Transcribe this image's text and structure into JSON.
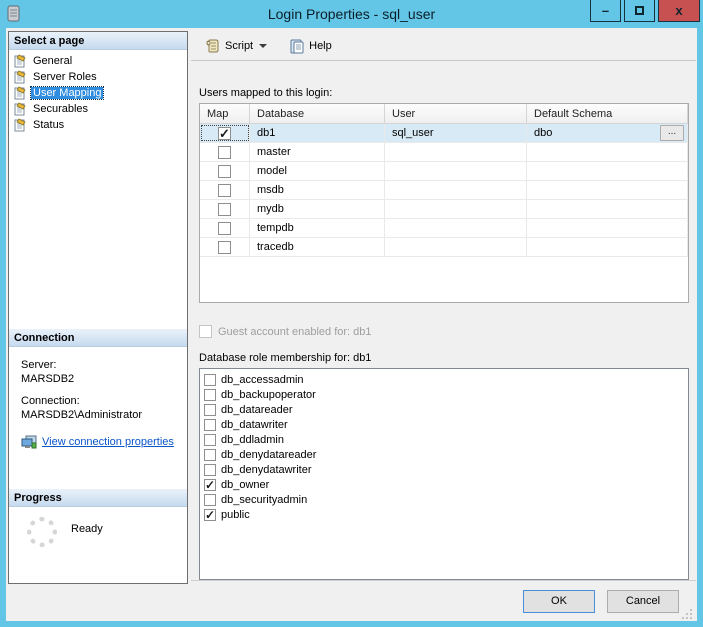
{
  "window": {
    "title": "Login Properties - sql_user",
    "controls": {
      "minimize": "–",
      "close": "x"
    }
  },
  "sidebar": {
    "select_page": {
      "header": "Select a page",
      "items": [
        {
          "label": "General",
          "selected": false
        },
        {
          "label": "Server Roles",
          "selected": false
        },
        {
          "label": "User Mapping",
          "selected": true
        },
        {
          "label": "Securables",
          "selected": false
        },
        {
          "label": "Status",
          "selected": false
        }
      ]
    },
    "connection": {
      "header": "Connection",
      "server_label": "Server:",
      "server_value": "MARSDB2",
      "connection_label": "Connection:",
      "connection_value": "MARSDB2\\Administrator",
      "link_label": "View connection properties"
    },
    "progress": {
      "header": "Progress",
      "status": "Ready"
    }
  },
  "toolbar": {
    "script_label": "Script",
    "help_label": "Help"
  },
  "main": {
    "users_mapped_label": "Users mapped to this login:",
    "table": {
      "columns": [
        "Map",
        "Database",
        "User",
        "Default Schema"
      ],
      "rows": [
        {
          "map": true,
          "database": "db1",
          "user": "sql_user",
          "schema": "dbo",
          "browse": "...",
          "selected": true
        },
        {
          "map": false,
          "database": "master",
          "user": "",
          "schema": ""
        },
        {
          "map": false,
          "database": "model",
          "user": "",
          "schema": ""
        },
        {
          "map": false,
          "database": "msdb",
          "user": "",
          "schema": ""
        },
        {
          "map": false,
          "database": "mydb",
          "user": "",
          "schema": ""
        },
        {
          "map": false,
          "database": "tempdb",
          "user": "",
          "schema": ""
        },
        {
          "map": false,
          "database": "tracedb",
          "user": "",
          "schema": ""
        }
      ]
    },
    "guest": {
      "label": "Guest account enabled for: db1",
      "checked": false
    },
    "roles_label": "Database role membership for: db1",
    "roles": [
      {
        "name": "db_accessadmin",
        "checked": false
      },
      {
        "name": "db_backupoperator",
        "checked": false
      },
      {
        "name": "db_datareader",
        "checked": false
      },
      {
        "name": "db_datawriter",
        "checked": false
      },
      {
        "name": "db_ddladmin",
        "checked": false
      },
      {
        "name": "db_denydatareader",
        "checked": false
      },
      {
        "name": "db_denydatawriter",
        "checked": false
      },
      {
        "name": "db_owner",
        "checked": true
      },
      {
        "name": "db_securityadmin",
        "checked": false
      },
      {
        "name": "public",
        "checked": true
      }
    ]
  },
  "footer": {
    "ok_label": "OK",
    "cancel_label": "Cancel"
  },
  "colors": {
    "accent_blue": "#63C6E6",
    "close_red": "#C75050",
    "selection_blue": "#2F8CDE",
    "selected_row": "#D8EAF6",
    "link_blue": "#0A55C8"
  }
}
